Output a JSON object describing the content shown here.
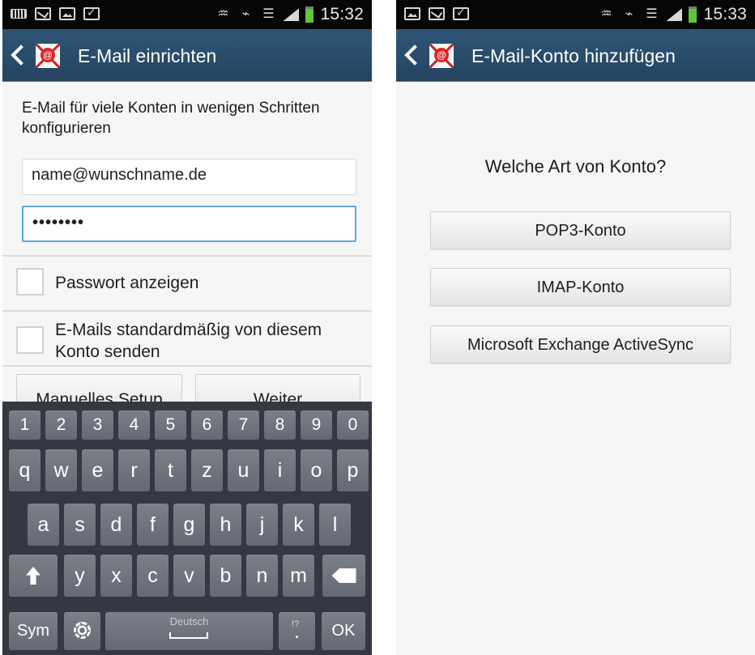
{
  "status_left": {
    "time": "15:32",
    "icons": [
      "keyboard-icon",
      "mail-icon",
      "image-icon",
      "bag-icon",
      "vibrate-icon",
      "nfc-icon",
      "wifi-icon",
      "signal-icon",
      "battery-icon"
    ]
  },
  "status_right": {
    "time": "15:33",
    "icons": [
      "image-icon",
      "mail-icon",
      "bag-icon",
      "vibrate-icon",
      "nfc-icon",
      "wifi-icon",
      "signal-icon",
      "battery-icon"
    ]
  },
  "left": {
    "title": "E-Mail einrichten",
    "intro": "E-Mail für viele Konten in wenigen Schritten konfigurieren",
    "email_value": "name@wunschname.de",
    "password_value": "••••••••",
    "show_password_label": "Passwort anzeigen",
    "default_send_label": "E-Mails standardmäßig von diesem Konto senden",
    "manual_setup_label": "Manuelles Setup",
    "next_label": "Weiter"
  },
  "keyboard": {
    "number_row": [
      "1",
      "2",
      "3",
      "4",
      "5",
      "6",
      "7",
      "8",
      "9",
      "0"
    ],
    "row1": [
      "q",
      "w",
      "e",
      "r",
      "t",
      "z",
      "u",
      "i",
      "o",
      "p"
    ],
    "row2": [
      "a",
      "s",
      "d",
      "f",
      "g",
      "h",
      "j",
      "k",
      "l"
    ],
    "row3": [
      "y",
      "x",
      "c",
      "v",
      "b",
      "n",
      "m"
    ],
    "sym_label": "Sym",
    "settings_hint": "...",
    "space_label": "Deutsch",
    "punctuation_label": ".",
    "punctuation_hint": "!?",
    "ok_label": "OK"
  },
  "right": {
    "title": "E-Mail-Konto hinzufügen",
    "question": "Welche Art von Konto?",
    "options": [
      "POP3-Konto",
      "IMAP-Konto",
      "Microsoft Exchange ActiveSync"
    ]
  }
}
